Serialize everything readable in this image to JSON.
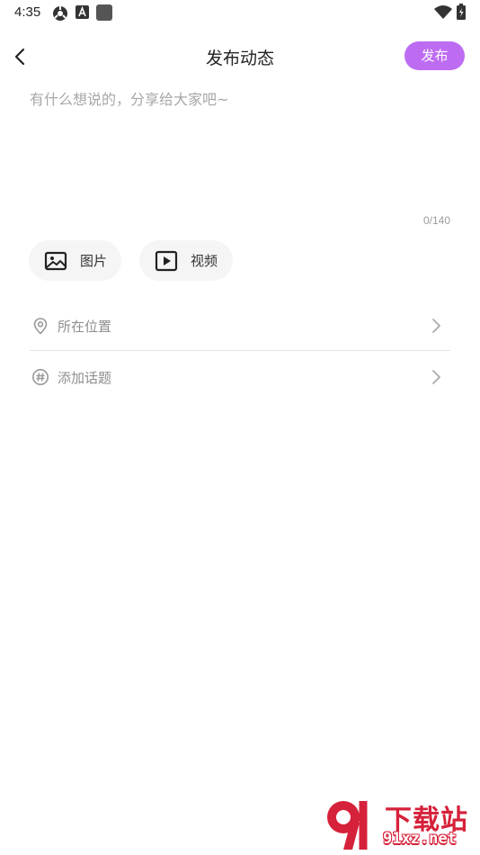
{
  "status_bar": {
    "time": "4:35",
    "left_icons": [
      "settings-icon",
      "font-a-icon",
      "square-app-icon"
    ],
    "right_icons": [
      "wifi-icon",
      "battery-icon"
    ]
  },
  "header": {
    "title": "发布动态",
    "publish_label": "发布",
    "back_icon": "chevron-left-icon"
  },
  "composer": {
    "placeholder": "有什么想说的，分享给大家吧~",
    "value": "",
    "char_count": "0/140"
  },
  "media": [
    {
      "label": "图片",
      "icon": "image-icon"
    },
    {
      "label": "视频",
      "icon": "video-icon"
    }
  ],
  "options": [
    {
      "label": "所在位置",
      "icon": "location-pin-icon"
    },
    {
      "label": "添加话题",
      "icon": "hashtag-icon"
    }
  ],
  "watermark": {
    "title": "下载站",
    "url": "91xz.net"
  },
  "colors": {
    "accent": "#bd6cf2",
    "watermark_red": "#d6213a",
    "placeholder": "#a7a7a7",
    "chip_bg": "#f5f5f5"
  }
}
